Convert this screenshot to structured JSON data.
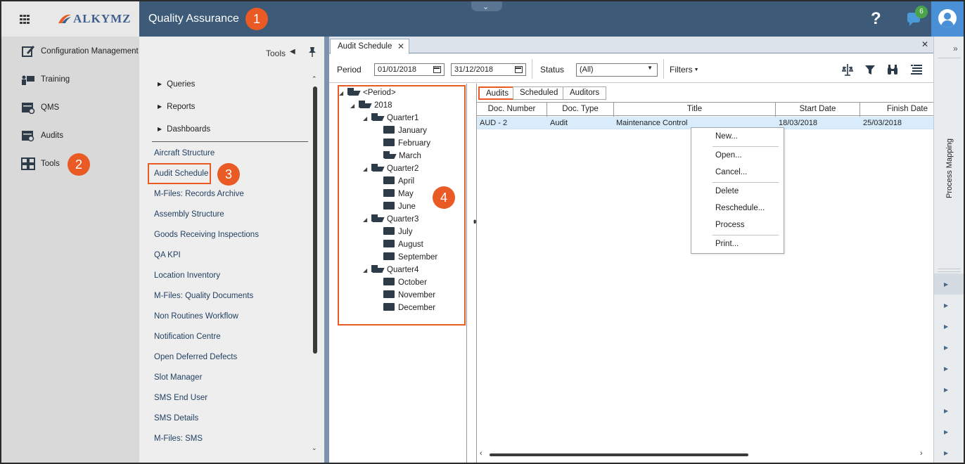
{
  "header": {
    "logo_text": "ALKYMZ",
    "module_title": "Quality Assurance",
    "help_label": "?",
    "notification_count": "6",
    "callouts": [
      "1",
      "2",
      "3",
      "4"
    ]
  },
  "left_nav": {
    "items": [
      {
        "label": "Configuration Management",
        "icon": "edit-document-icon"
      },
      {
        "label": "Training",
        "icon": "training-icon"
      },
      {
        "label": "QMS",
        "icon": "qms-icon"
      },
      {
        "label": "Audits",
        "icon": "audit-icon"
      },
      {
        "label": "Tools",
        "icon": "tools-grid-icon"
      }
    ]
  },
  "tools_panel": {
    "title": "Tools",
    "categories": [
      "Queries",
      "Reports",
      "Dashboards"
    ],
    "links": [
      "Aircraft Structure",
      "Audit Schedule",
      "M-Files: Records Archive",
      "Assembly Structure",
      "Goods Receiving Inspections",
      "QA KPI",
      "Location Inventory",
      "M-Files: Quality Documents",
      "Non Routines Workflow",
      "Notification Centre",
      "Open Deferred Defects",
      "Slot Manager",
      "SMS End User",
      "SMS Details",
      "M-Files: SMS"
    ]
  },
  "document_tab": {
    "label": "Audit Schedule",
    "close": "✕"
  },
  "filter_bar": {
    "period_label": "Period",
    "date_from": "01/01/2018",
    "date_to": "31/12/2018",
    "status_label": "Status",
    "status_value": "(All)",
    "filters_label": "Filters"
  },
  "tree": {
    "root": "<Period>",
    "year": "2018",
    "quarters": [
      {
        "label": "Quarter1",
        "months": [
          "January",
          "February",
          "March"
        ]
      },
      {
        "label": "Quarter2",
        "months": [
          "April",
          "May",
          "June"
        ]
      },
      {
        "label": "Quarter3",
        "months": [
          "July",
          "August",
          "September"
        ]
      },
      {
        "label": "Quarter4",
        "months": [
          "October",
          "November",
          "December"
        ]
      }
    ]
  },
  "grid": {
    "subtabs": [
      "Audits",
      "Scheduled",
      "Auditors"
    ],
    "columns": [
      "Doc. Number",
      "Doc. Type",
      "Title",
      "Start Date",
      "Finish Date"
    ],
    "rows": [
      {
        "doc_number": "AUD - 2",
        "doc_type": "Audit",
        "title": "Maintenance Control",
        "start_date": "18/03/2018",
        "finish_date": "25/03/2018"
      }
    ]
  },
  "context_menu": {
    "items": [
      "New...",
      "Open...",
      "Cancel...",
      "Delete",
      "Reschedule...",
      "Process",
      "Print..."
    ]
  },
  "right_rail": {
    "label": "Process Mapping",
    "expand": "»"
  },
  "colors": {
    "header_bg": "#3d5a78",
    "accent_callout": "#e95a24",
    "selected_row": "#d9ecfb",
    "user_area": "#4a90d6"
  }
}
